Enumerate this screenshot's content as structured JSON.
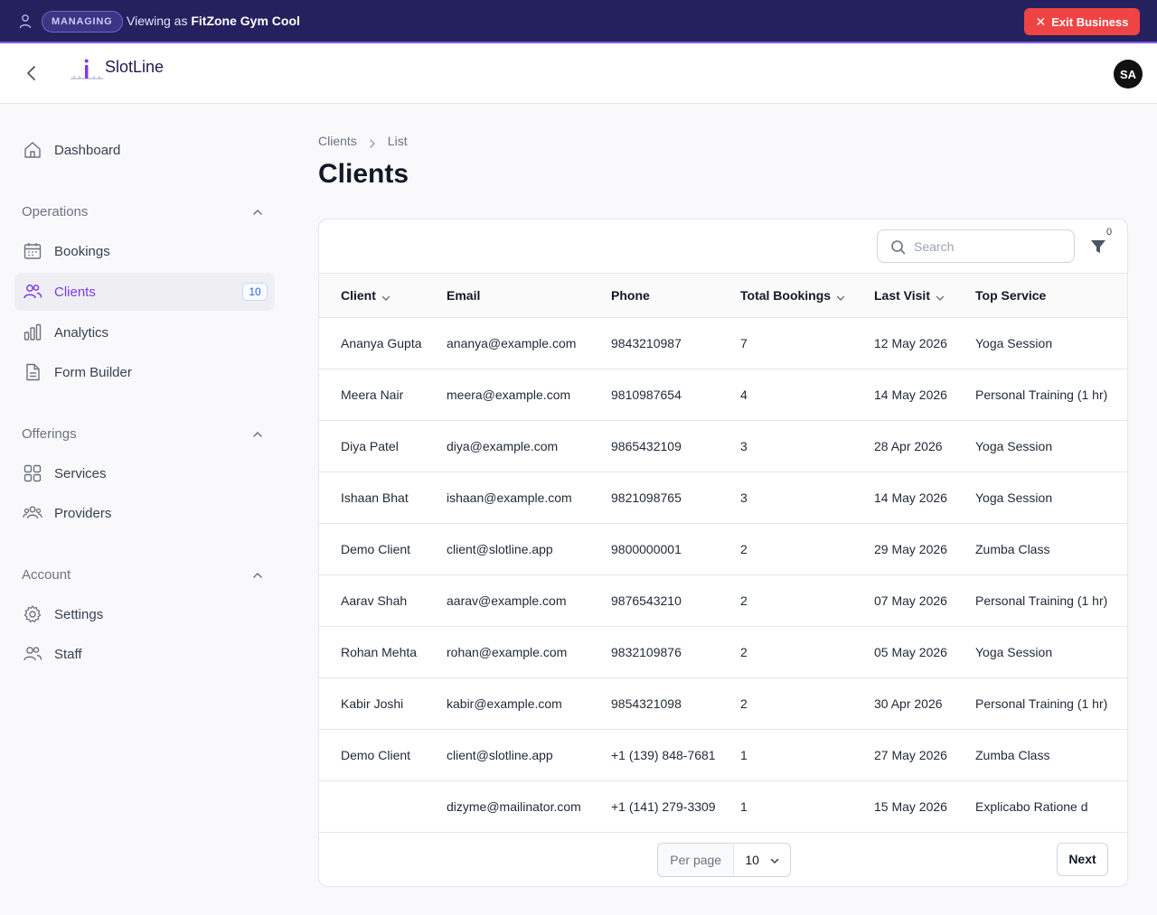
{
  "banner": {
    "managing_label": "MANAGING",
    "viewing_prefix": "Viewing as",
    "business_name": "FitZone Gym Cool",
    "exit_label": "Exit Business"
  },
  "header": {
    "app_name": "SlotLine",
    "avatar_initials": "SA"
  },
  "sidebar": {
    "dashboard": "Dashboard",
    "groups": {
      "operations": "Operations",
      "offerings": "Offerings",
      "account": "Account"
    },
    "items": {
      "bookings": "Bookings",
      "clients": "Clients",
      "clients_count": "10",
      "analytics": "Analytics",
      "form_builder": "Form Builder",
      "services": "Services",
      "providers": "Providers",
      "settings": "Settings",
      "staff": "Staff"
    }
  },
  "breadcrumb": {
    "parent": "Clients",
    "current": "List"
  },
  "page_title": "Clients",
  "toolbar": {
    "search_placeholder": "Search",
    "filter_count": "0"
  },
  "table": {
    "columns": {
      "client": "Client",
      "email": "Email",
      "phone": "Phone",
      "total_bookings": "Total Bookings",
      "last_visit": "Last Visit",
      "top_service": "Top Service"
    },
    "rows": [
      {
        "client": "Ananya Gupta",
        "email": "ananya@example.com",
        "phone": "9843210987",
        "total": "7",
        "last_visit": "12 May 2026",
        "top_service": "Yoga Session"
      },
      {
        "client": "Meera Nair",
        "email": "meera@example.com",
        "phone": "9810987654",
        "total": "4",
        "last_visit": "14 May 2026",
        "top_service": "Personal Training (1 hr)"
      },
      {
        "client": "Diya Patel",
        "email": "diya@example.com",
        "phone": "9865432109",
        "total": "3",
        "last_visit": "28 Apr 2026",
        "top_service": "Yoga Session"
      },
      {
        "client": "Ishaan Bhat",
        "email": "ishaan@example.com",
        "phone": "9821098765",
        "total": "3",
        "last_visit": "14 May 2026",
        "top_service": "Yoga Session"
      },
      {
        "client": "Demo Client",
        "email": "client@slotline.app",
        "phone": "9800000001",
        "total": "2",
        "last_visit": "29 May 2026",
        "top_service": "Zumba Class"
      },
      {
        "client": "Aarav Shah",
        "email": "aarav@example.com",
        "phone": "9876543210",
        "total": "2",
        "last_visit": "07 May 2026",
        "top_service": "Personal Training (1 hr)"
      },
      {
        "client": "Rohan Mehta",
        "email": "rohan@example.com",
        "phone": "9832109876",
        "total": "2",
        "last_visit": "05 May 2026",
        "top_service": "Yoga Session"
      },
      {
        "client": "Kabir Joshi",
        "email": "kabir@example.com",
        "phone": "9854321098",
        "total": "2",
        "last_visit": "30 Apr 2026",
        "top_service": "Personal Training (1 hr)"
      },
      {
        "client": "Demo Client",
        "email": "client@slotline.app",
        "phone": "+1 (139) 848-7681",
        "total": "1",
        "last_visit": "27 May 2026",
        "top_service": "Zumba Class"
      },
      {
        "client": "",
        "email": "dizyme@mailinator.com",
        "phone": "+1 (141) 279-3309",
        "total": "1",
        "last_visit": "15 May 2026",
        "top_service": "Explicabo Ratione d"
      }
    ]
  },
  "pagination": {
    "per_page_label": "Per page",
    "per_page_value": "10",
    "next_label": "Next"
  },
  "colors": {
    "banner_bg": "#25215e",
    "accent": "#7c3aed",
    "exit_red": "#ef4444"
  }
}
